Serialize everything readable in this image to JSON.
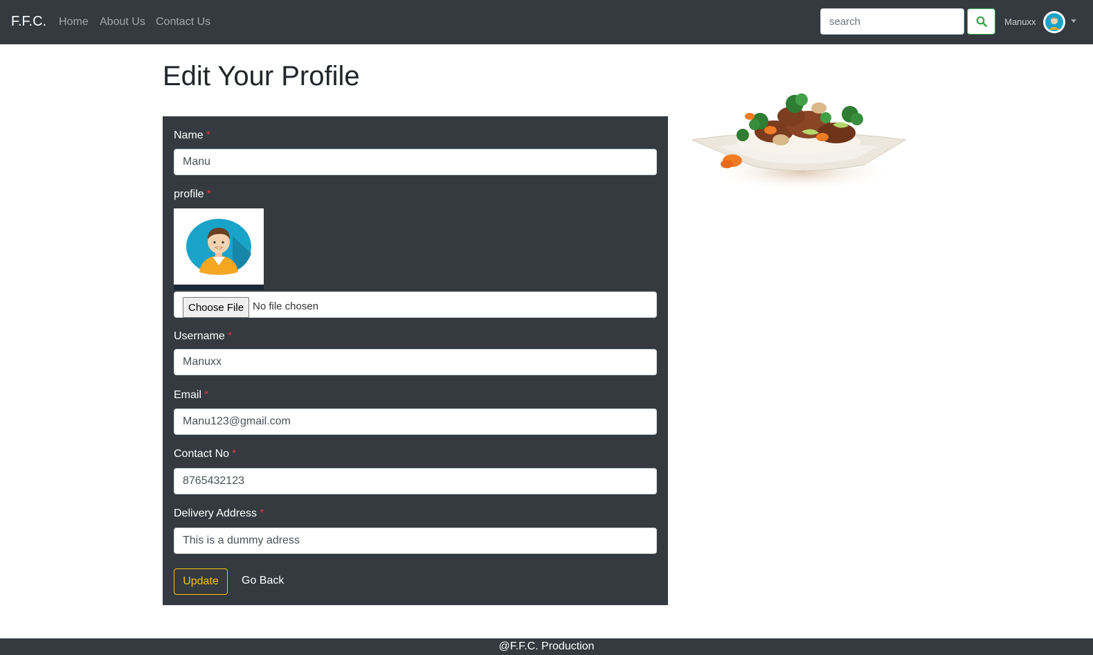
{
  "navbar": {
    "brand": "F.F.C.",
    "links": [
      "Home",
      "About Us",
      "Contact Us"
    ],
    "search_placeholder": "search",
    "username": "Manuxx"
  },
  "page": {
    "title": "Edit Your Profile"
  },
  "form": {
    "name_label": "Name",
    "name_value": "Manu",
    "profile_label": "profile",
    "choose_file_label": "Choose File",
    "no_file_text": "No file chosen",
    "username_label": "Username",
    "username_value": "Manuxx",
    "email_label": "Email",
    "email_value": "Manu123@gmail.com",
    "contact_label": "Contact No",
    "contact_value": "8765432123",
    "address_label": "Delivery Address",
    "address_value": "This is a dummy adress",
    "required_mark": "*",
    "update_label": "Update",
    "go_back_label": "Go Back"
  },
  "footer": {
    "text": "@F.F.C. Production"
  },
  "colors": {
    "navbar_bg": "#343a40",
    "form_bg": "#343a40",
    "required": "#dc3545",
    "update_accent": "#ffc107",
    "search_btn_accent": "#28a745"
  }
}
